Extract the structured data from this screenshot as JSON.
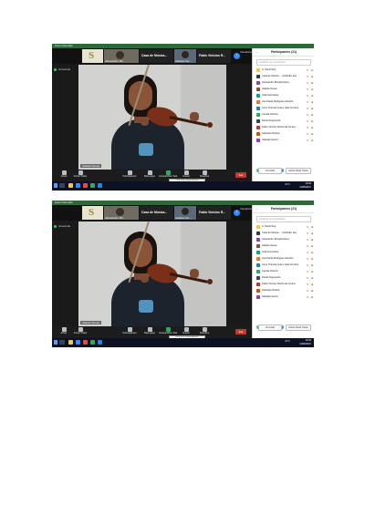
{
  "window": {
    "title": "Zoom Reunião"
  },
  "thumbnails": [
    {
      "name": "",
      "kind": "logo",
      "logo_letter": "S"
    },
    {
      "name": "Alessandro Bri..."
    },
    {
      "name": "Casa de Música..."
    },
    {
      "name": "Isabela Cor..."
    },
    {
      "name": "Fabio Vinicius R..."
    }
  ],
  "view_label": "Visualizar",
  "recording_label": "Gravando",
  "main_video": {
    "name": "Isabela Sousa"
  },
  "toolbar": {
    "items": [
      {
        "label": "Ativar"
      },
      {
        "label": "Iniciar Vídeo"
      },
      {
        "label": "Participantes"
      },
      {
        "label": "Bate-papo"
      },
      {
        "label": "Compartilhar Tela"
      },
      {
        "label": "Gravar"
      },
      {
        "label": "Reações"
      }
    ],
    "leave_label": "Sair",
    "share_tooltip": "Você está compartilhando"
  },
  "taskbar": {
    "temp": "26°C",
    "time": "19:32",
    "date": "11/06/2021"
  },
  "participants": {
    "title": "Participantes (21)",
    "search_placeholder": "Localizar um participante",
    "list": [
      {
        "name": "A. Santil (Eu)",
        "avatar_color": "#f4c542"
      },
      {
        "name": "Casa de Música ... (Anfitrião, Eu)",
        "avatar_color": "#2c3e50"
      },
      {
        "name": "Alessandro Bringhenti(eu)",
        "avatar_color": "#8e44ad"
      },
      {
        "name": "Isabela Sousa",
        "avatar_color": "#7f5539"
      },
      {
        "name": "Júlia Gonçalves",
        "avatar_color": "#16a085"
      },
      {
        "name": "Ana Paula Rodrigues Zanolini",
        "avatar_color": "#e67e22"
      },
      {
        "name": "Anne Theresa Leal e Gaia Ferreira",
        "avatar_color": "#2980b9"
      },
      {
        "name": "Camila Oliveira",
        "avatar_color": "#27ae60"
      },
      {
        "name": "Daniel Figueiredo",
        "avatar_color": "#34495e"
      },
      {
        "name": "Fabio Vinícius Rocha da Cunha",
        "avatar_color": "#c0392b"
      },
      {
        "name": "Gabriela Oliveira",
        "avatar_color": "#d35400"
      },
      {
        "name": "Isabella Guerra",
        "avatar_color": "#8e44ad"
      }
    ],
    "reaction_colors": [
      "#2ecc71",
      "#3498db",
      "#e74c3c",
      "#9b59b6",
      "#3498db",
      "#1abc9c"
    ],
    "invite_label": "Convidar",
    "mute_all_label": "Ativar Mudo Todos"
  }
}
